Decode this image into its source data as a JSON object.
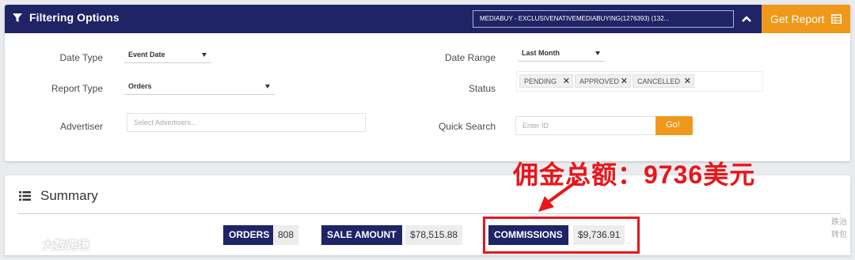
{
  "header": {
    "title": "Filtering Options",
    "campaign_value": "MEDIABUY - EXCLUSIVENATIVEMEDIABUYING(1276393) (132...",
    "get_report_label": "Get Report",
    "colors": {
      "navy": "#1f2466",
      "orange": "#f0981a"
    }
  },
  "filters": {
    "date_type": {
      "label": "Date Type",
      "value": "Event Date"
    },
    "report_type": {
      "label": "Report Type",
      "value": "Orders"
    },
    "advertiser": {
      "label": "Advertiser",
      "placeholder": "Select Advertisers..."
    },
    "date_range": {
      "label": "Date Range",
      "value": "Last Month"
    },
    "status": {
      "label": "Status",
      "tags": [
        "PENDING",
        "APPROVED",
        "CANCELLED"
      ]
    },
    "quick_search": {
      "label": "Quick Search",
      "placeholder": "Enter ID",
      "button_label": "Go!"
    }
  },
  "summary": {
    "title": "Summary",
    "metrics": [
      {
        "label": "ORDERS",
        "value": "808"
      },
      {
        "label": "SALE AMOUNT",
        "value": "$78,515.88"
      },
      {
        "label": "COMMISSIONS",
        "value": "$9,736.91"
      }
    ]
  },
  "annotation": {
    "text": "佣金总额：9736美元",
    "color": "#e8161b"
  },
  "watermark": {
    "text": "大数跨境"
  },
  "side_text": [
    "跌治",
    "转包"
  ]
}
